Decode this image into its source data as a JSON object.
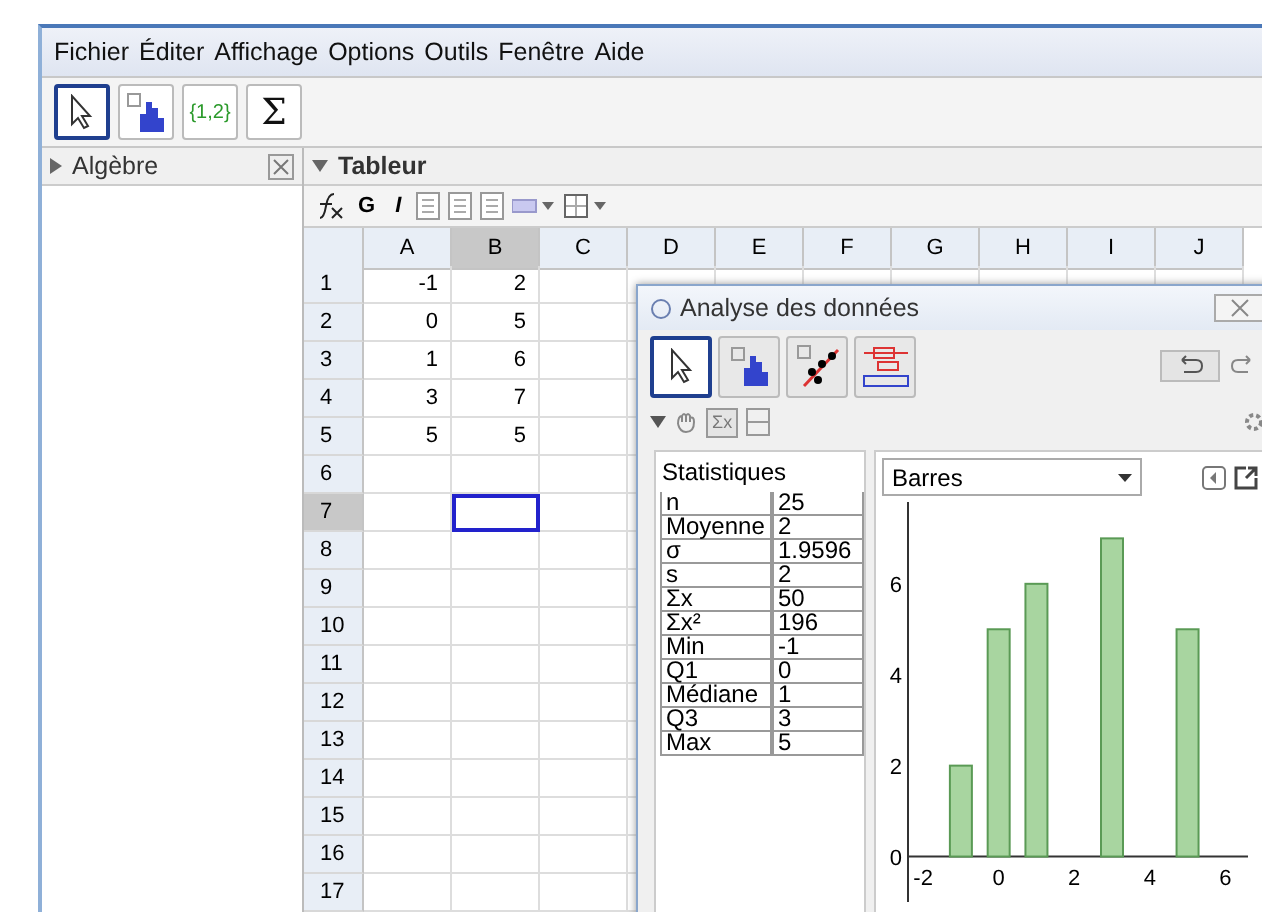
{
  "menu": [
    "Fichier",
    "Éditer",
    "Affichage",
    "Options",
    "Outils",
    "Fenêtre",
    "Aide"
  ],
  "toolbar": [
    {
      "kind": "pointer",
      "selected": true
    },
    {
      "kind": "bars",
      "selected": false
    },
    {
      "kind": "list",
      "label": "{1,2}",
      "selected": false
    },
    {
      "kind": "sum",
      "label": "Σ",
      "selected": false
    }
  ],
  "algebra": {
    "title": "Algèbre"
  },
  "spreadsheet": {
    "title": "Tableur",
    "format_buttons": [
      "G",
      "I"
    ],
    "columns": [
      {
        "label": "A",
        "selected": false
      },
      {
        "label": "B",
        "selected": true
      },
      {
        "label": "C",
        "selected": false
      },
      {
        "label": "D",
        "selected": false
      },
      {
        "label": "E",
        "selected": false
      },
      {
        "label": "F",
        "selected": false
      },
      {
        "label": "G",
        "selected": false
      },
      {
        "label": "H",
        "selected": false
      },
      {
        "label": "I",
        "selected": false
      },
      {
        "label": "J",
        "selected": false
      }
    ],
    "rows": [
      {
        "label": "1",
        "selected": false,
        "cells": [
          "-1",
          "2"
        ]
      },
      {
        "label": "2",
        "selected": false,
        "cells": [
          "0",
          "5"
        ]
      },
      {
        "label": "3",
        "selected": false,
        "cells": [
          "1",
          "6"
        ]
      },
      {
        "label": "4",
        "selected": false,
        "cells": [
          "3",
          "7"
        ]
      },
      {
        "label": "5",
        "selected": false,
        "cells": [
          "5",
          "5"
        ]
      },
      {
        "label": "6",
        "selected": false
      },
      {
        "label": "7",
        "selected": true
      },
      {
        "label": "8",
        "selected": false
      },
      {
        "label": "9",
        "selected": false
      },
      {
        "label": "10",
        "selected": false
      },
      {
        "label": "11",
        "selected": false
      },
      {
        "label": "12",
        "selected": false
      },
      {
        "label": "13",
        "selected": false
      },
      {
        "label": "14",
        "selected": false
      },
      {
        "label": "15",
        "selected": false
      },
      {
        "label": "16",
        "selected": false
      },
      {
        "label": "17",
        "selected": false
      }
    ]
  },
  "dialog": {
    "title": "Analyse des données",
    "tools": [
      {
        "kind": "pointer",
        "selected": true
      },
      {
        "kind": "bars",
        "selected": false
      },
      {
        "kind": "scatter",
        "selected": false
      },
      {
        "kind": "boxplot",
        "selected": false
      }
    ],
    "stats_toggle": "Σx",
    "stats": {
      "title": "Statistiques",
      "rows": [
        {
          "label": "n",
          "value": "25"
        },
        {
          "label": "Moyenne",
          "value": "2"
        },
        {
          "label": "σ",
          "value": "1.9596"
        },
        {
          "label": "s",
          "value": "2"
        },
        {
          "label": "Σx",
          "value": "50"
        },
        {
          "label": "Σx²",
          "value": "196"
        },
        {
          "label": "Min",
          "value": "-1"
        },
        {
          "label": "Q1",
          "value": "0"
        },
        {
          "label": "Médiane",
          "value": "1"
        },
        {
          "label": "Q3",
          "value": "3"
        },
        {
          "label": "Max",
          "value": "5"
        }
      ]
    },
    "chart_select": "Barres",
    "chart_data": {
      "type": "bar",
      "x": [
        -1,
        0,
        1,
        3,
        5
      ],
      "series": [
        {
          "color": "#a8d5a0",
          "values": [
            2,
            5,
            6,
            7,
            5
          ]
        }
      ],
      "xlim": [
        -2.4,
        6.6
      ],
      "ylim": [
        -1,
        7.8
      ],
      "xticks": [
        -2,
        0,
        2,
        4,
        6
      ],
      "yticks": [
        0,
        2,
        4,
        6
      ]
    }
  }
}
